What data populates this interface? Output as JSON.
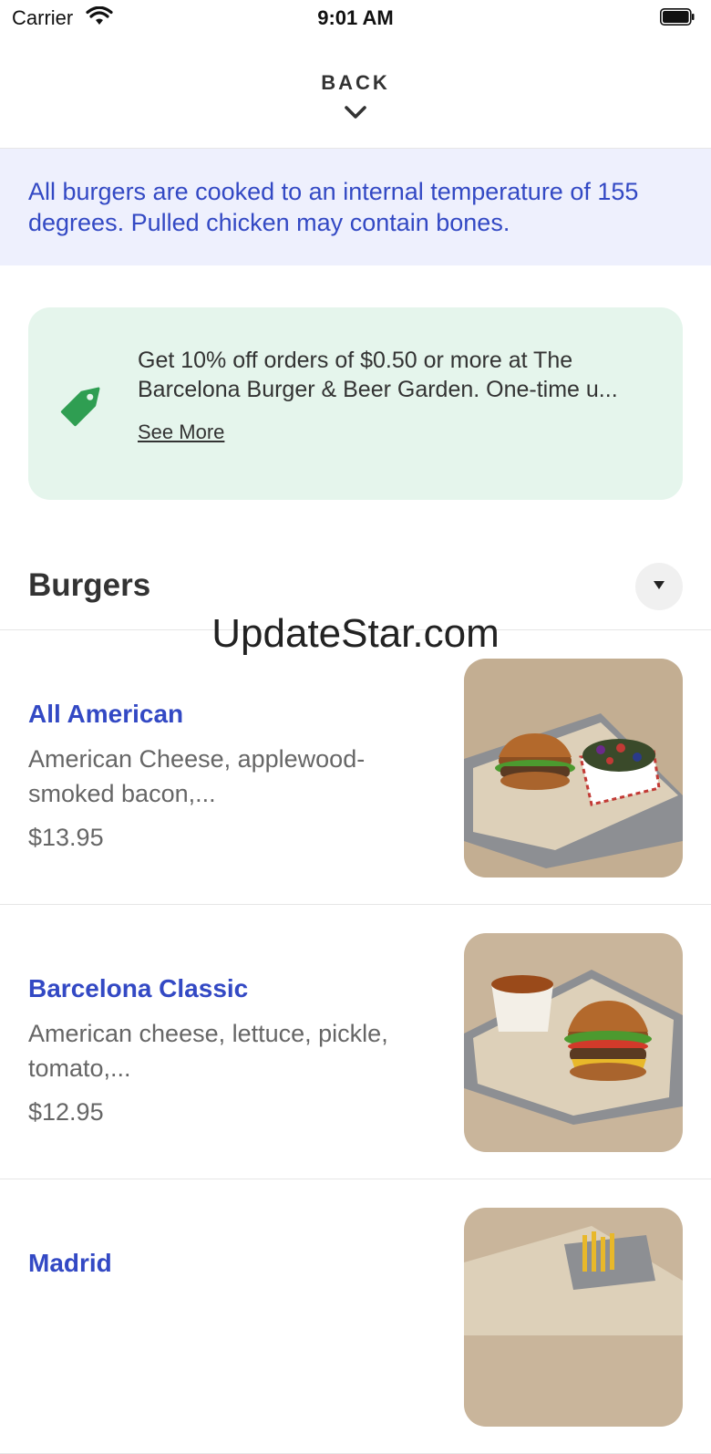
{
  "status_bar": {
    "carrier": "Carrier",
    "time": "9:01 AM"
  },
  "header": {
    "back_label": "BACK",
    "back_icon": "chevron-down-icon"
  },
  "notice": {
    "text": "All burgers are cooked to an internal temperature of 155 degrees. Pulled chicken may contain bones."
  },
  "promo": {
    "line1": "Get 10% off orders of $0.50 or more at The",
    "line2": "Barcelona Burger & Beer Garden. One-time u...",
    "link": "See More",
    "icon": "tag-icon",
    "color": "#2f9e52"
  },
  "section": {
    "title": "Burgers",
    "toggle_icon": "caret-down-icon"
  },
  "watermark": "UpdateStar.com",
  "items": [
    {
      "name": "All American",
      "desc_line1": "American Cheese, applewood-",
      "desc_line2": "smoked bacon,...",
      "price": "$13.95"
    },
    {
      "name": "Barcelona Classic",
      "desc_line1": "American cheese, lettuce, pickle,",
      "desc_line2": "tomato,...",
      "price": "$12.95"
    },
    {
      "name": "Madrid",
      "desc_line1": "",
      "desc_line2": "",
      "price": ""
    }
  ],
  "colors": {
    "accent": "#3349c4",
    "notice_bg": "#eef0fd",
    "promo_bg": "#e5f5ec"
  }
}
